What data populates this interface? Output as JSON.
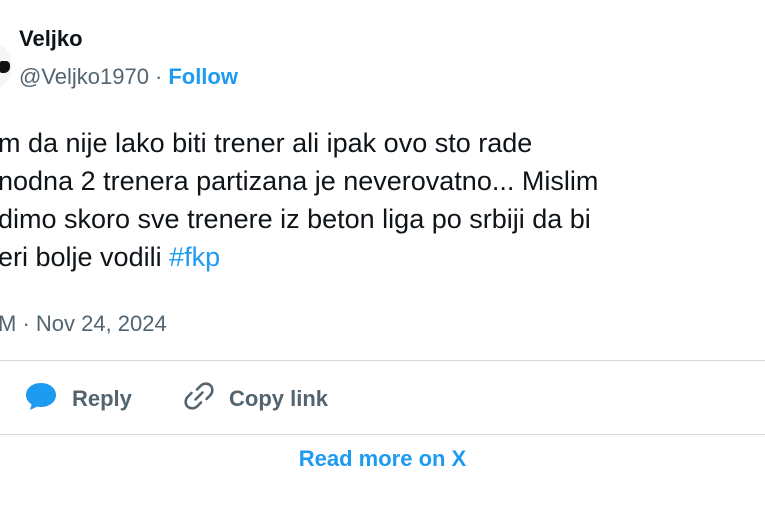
{
  "author": {
    "name": "Veljko",
    "handle": "@Veljko1970",
    "separator": "·",
    "follow_label": "Follow"
  },
  "tweet": {
    "lines": [
      "m da nije lako biti trener ali ipak ovo sto rade",
      "nodna 2 trenera partizana je neverovatno... Mislim",
      "dimo skoro sve trenere iz beton liga po srbiji da bi",
      "eri bolje vodili "
    ],
    "hashtag": "#fkp",
    "timestamp": "M · Nov 24, 2024"
  },
  "actions": {
    "reply_label": "Reply",
    "copy_link_label": "Copy link"
  },
  "footer": {
    "read_more_label": "Read more on X"
  },
  "colors": {
    "accent": "#1d9bf0",
    "text": "#0f1419",
    "muted": "#536471",
    "divider": "#cfd9de"
  },
  "icons": {
    "reply": "speech-bubble-icon",
    "copy_link": "chain-link-icon"
  }
}
